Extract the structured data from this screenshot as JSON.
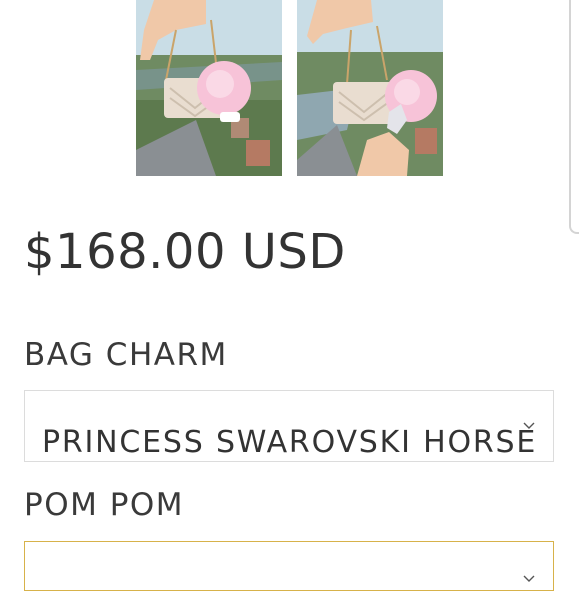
{
  "product": {
    "price": "$168.00 USD",
    "images": [
      {
        "icon": "product-photo-bag-with-pink-pompom"
      },
      {
        "icon": "product-photo-bag-with-horse-charm"
      }
    ]
  },
  "options": {
    "bag_charm": {
      "label": "BAG CHARM",
      "selected": "PRINCESS SWAROVSKI HORSE",
      "icon": "chevron-down-icon"
    },
    "pom_pom": {
      "label": "POM POM",
      "selected": "",
      "icon": "chevron-down-icon",
      "focus_color": "#d7b24a"
    }
  }
}
